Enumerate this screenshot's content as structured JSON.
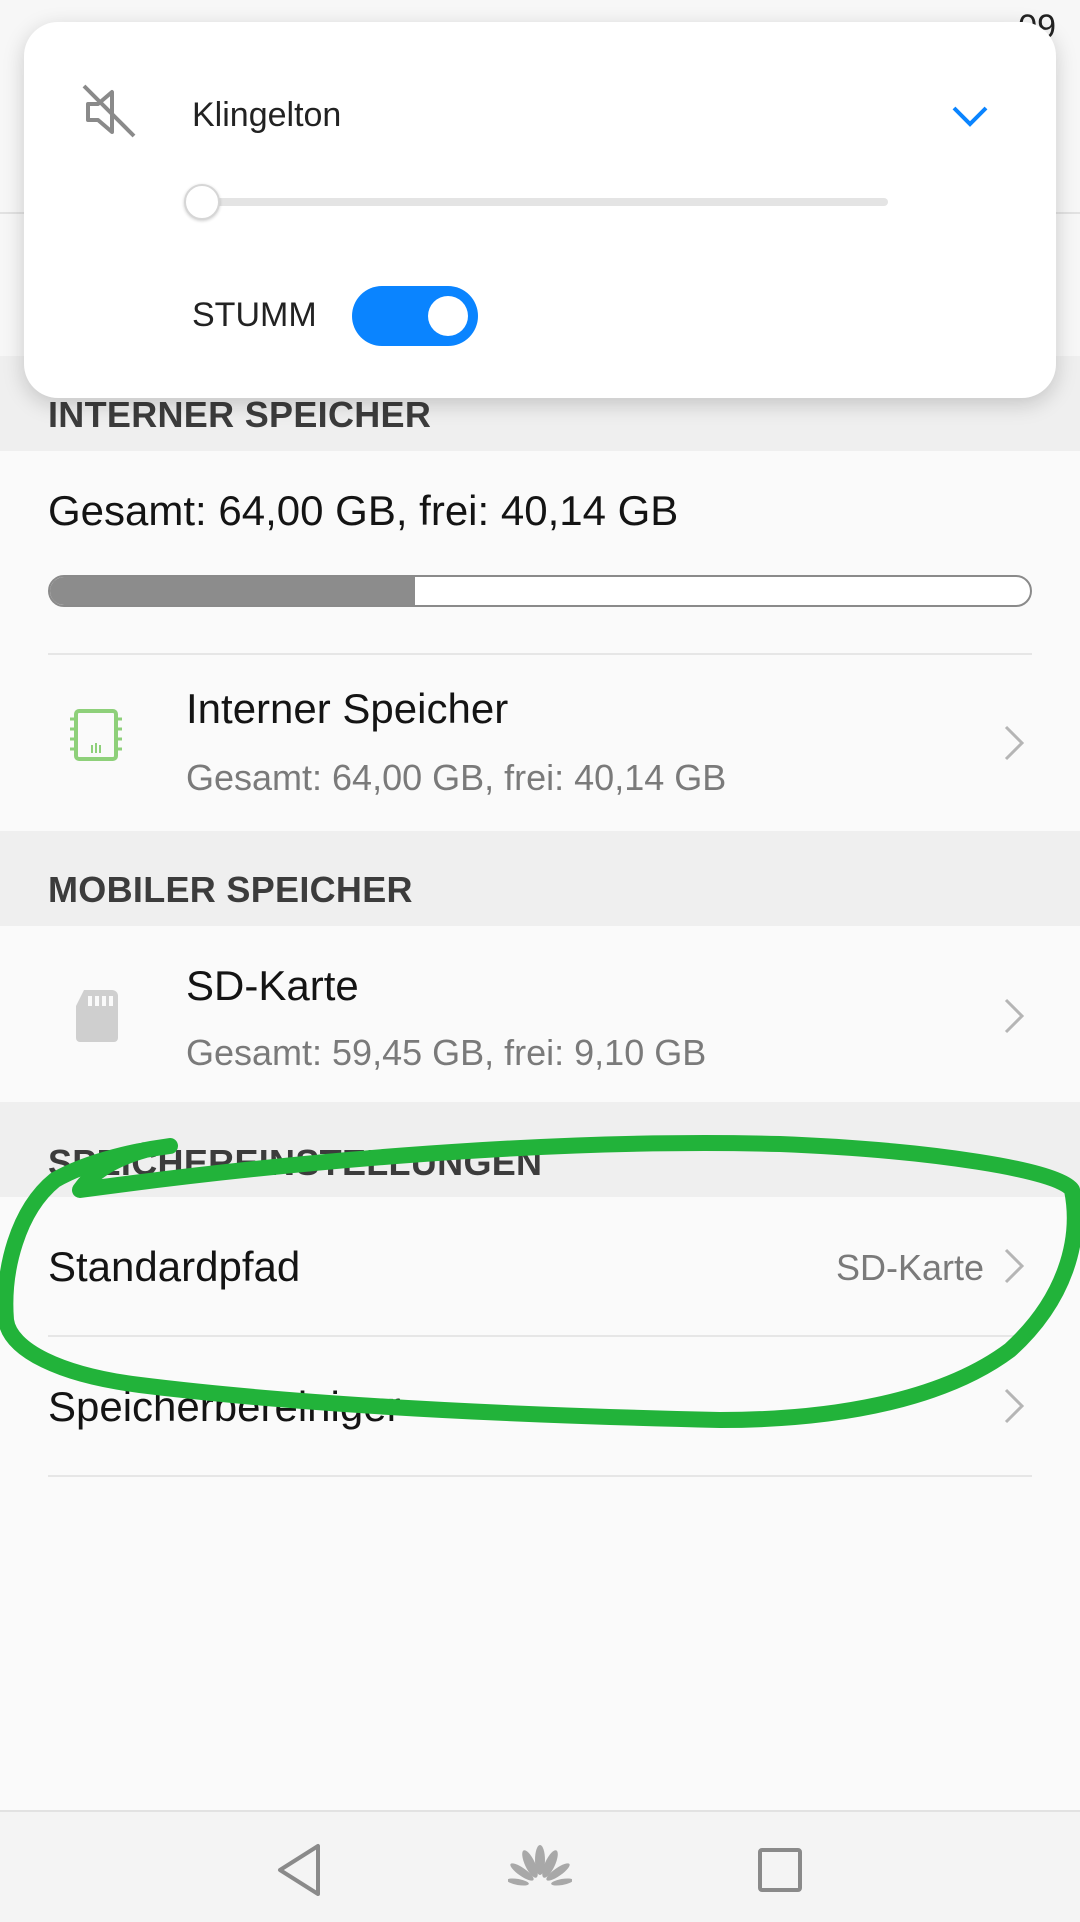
{
  "status_bar": {
    "time": "09"
  },
  "volume_panel": {
    "title": "Klingelton",
    "mute_label": "STUMM",
    "ringtone_level": 0,
    "mute_enabled": true,
    "accent_color": "#0a84ff"
  },
  "internal_header": "INTERNER SPEICHER",
  "internal_summary": {
    "text": "Gesamt: 64,00 GB, frei: 40,14 GB",
    "used_fraction": 0.3728
  },
  "internal_item": {
    "title": "Interner Speicher",
    "subtitle": "Gesamt: 64,00 GB, frei: 40,14 GB",
    "icon": "chip-icon"
  },
  "mobile_header": "MOBILER SPEICHER",
  "sd_item": {
    "title": "SD-Karte",
    "subtitle": "Gesamt: 59,45 GB, frei: 9,10 GB",
    "icon": "sd-card-icon"
  },
  "settings_header": "SPEICHEREINSTELLUNGEN",
  "default_path": {
    "label": "Standardpfad",
    "value": "SD-Karte"
  },
  "cleaner": {
    "label": "Speicherbereiniger"
  },
  "colors": {
    "annotation": "#22b33a",
    "chip_icon": "#8ed07a"
  }
}
